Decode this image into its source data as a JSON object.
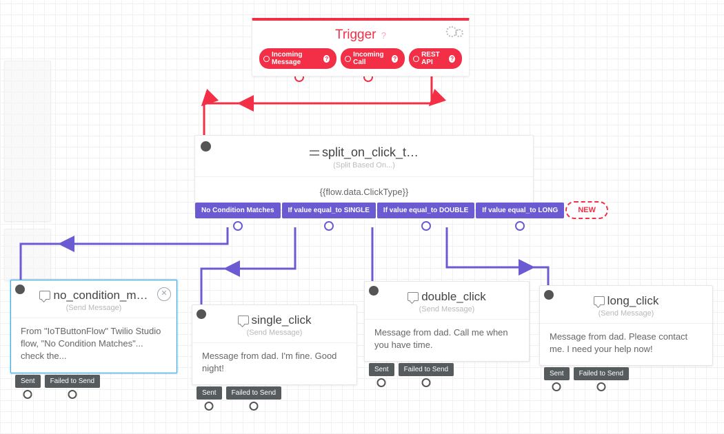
{
  "colors": {
    "accent": "#f22f46",
    "purple": "#6b5bd2",
    "selection": "#2aa3ff"
  },
  "trigger": {
    "title": "Trigger",
    "events": {
      "incoming_message": "Incoming Message",
      "incoming_call": "Incoming Call",
      "rest_api": "REST API"
    }
  },
  "split": {
    "title": "split_on_click_t…",
    "subtitle": "(Split Based On...)",
    "expression": "{{flow.data.ClickType}}",
    "branches": {
      "no_match": "No Condition Matches",
      "single": "If value equal_to SINGLE",
      "double": "If value equal_to DOUBLE",
      "long": "If value equal_to LONG"
    },
    "new_label": "NEW"
  },
  "widgets": {
    "no_condition": {
      "title": "no_condition_m…",
      "subtitle": "(Send Message)",
      "body": "From \"IoTButtonFlow\" Twilio Studio flow, \"No Condition Matches\"... check the...",
      "out": {
        "sent": "Sent",
        "failed": "Failed to Send"
      }
    },
    "single": {
      "title": "single_click",
      "subtitle": "(Send Message)",
      "body": "Message from dad. I'm fine. Good night!",
      "out": {
        "sent": "Sent",
        "failed": "Failed to Send"
      }
    },
    "double": {
      "title": "double_click",
      "subtitle": "(Send Message)",
      "body": "Message from dad. Call me when you have time.",
      "out": {
        "sent": "Sent",
        "failed": "Failed to Send"
      }
    },
    "long": {
      "title": "long_click",
      "subtitle": "(Send Message)",
      "body": "Message from dad. Please contact me. I need your help now!",
      "out": {
        "sent": "Sent",
        "failed": "Failed to Send"
      }
    }
  }
}
